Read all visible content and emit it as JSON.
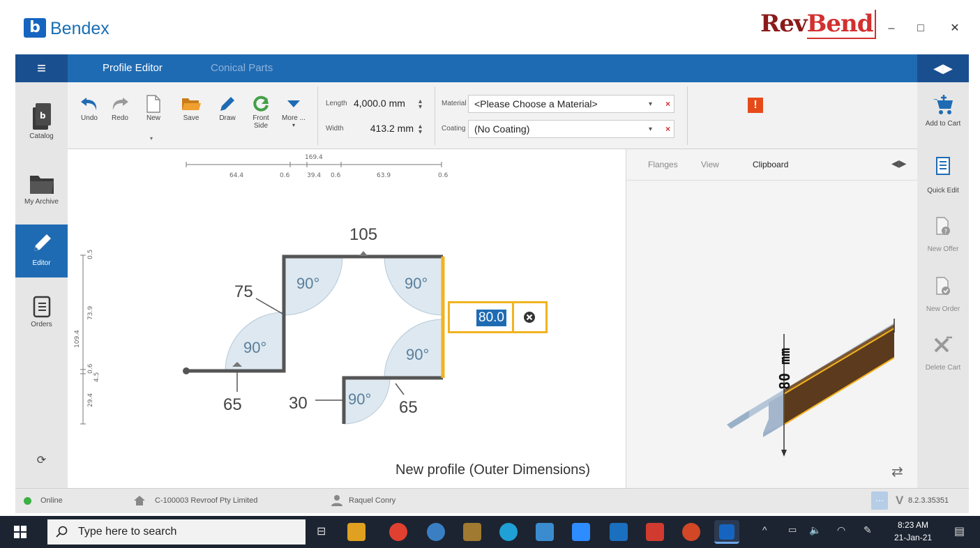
{
  "app": {
    "title": "Bendex",
    "logo_letter": "b",
    "brand_left": "Rev",
    "brand_right": "Bend"
  },
  "window_controls": {
    "minimize": "–",
    "maximize": "□",
    "close": "✕"
  },
  "header": {
    "menu_icon": "hamburger-icon",
    "tabs": [
      {
        "label": "Profile Editor",
        "active": true
      },
      {
        "label": "Conical Parts",
        "active": false
      }
    ],
    "collapse_icon": "◀▶"
  },
  "sidebar": {
    "items": [
      {
        "label": "Catalog",
        "icon": "catalog-icon"
      },
      {
        "label": "My Archive",
        "icon": "folder-icon"
      },
      {
        "label": "Editor",
        "icon": "pencil-icon",
        "active": true
      },
      {
        "label": "Orders",
        "icon": "orders-icon"
      }
    ],
    "sync_icon": "⟳"
  },
  "toolbar": {
    "buttons": [
      {
        "label": "Undo"
      },
      {
        "label": "Redo"
      },
      {
        "label": "New"
      },
      {
        "label": "Save"
      },
      {
        "label": "Draw"
      },
      {
        "label": "Front Side"
      },
      {
        "label": "More ..."
      }
    ],
    "length_label": "Length",
    "length_value": "4,000.0 mm",
    "width_label": "Width",
    "width_value": "413.2 mm",
    "material_label": "Material",
    "material_value": "<Please Choose a Material>",
    "coating_label": "Coating",
    "coating_value": "(No Coating)",
    "warning": "!"
  },
  "right_sidebar": {
    "items": [
      {
        "label": "Add to Cart"
      },
      {
        "label": "Quick Edit"
      },
      {
        "label": "New Offer"
      },
      {
        "label": "New Order"
      },
      {
        "label": "Delete Cart"
      }
    ]
  },
  "canvas": {
    "dimension_total": "169.4",
    "dimension_segments": [
      "64.4",
      "0.6",
      "39.4",
      "0.6",
      "63.9",
      "0.6"
    ],
    "vertical_total": "109.4",
    "vertical_segments": [
      "0.5",
      "73.9",
      "0.6",
      "4.5",
      "29.4"
    ],
    "flange_labels": [
      "105",
      "75",
      "65",
      "30",
      "65"
    ],
    "angles": [
      "90°",
      "90°",
      "90°",
      "90°",
      "90°"
    ],
    "edit_value": "80.0",
    "profile_title": "New profile (Outer Dimensions)"
  },
  "right_panel": {
    "tabs": [
      {
        "label": "Flanges",
        "active": false
      },
      {
        "label": "View",
        "active": false
      },
      {
        "label": "Clipboard",
        "active": true
      }
    ],
    "dimension_label": "80 mm"
  },
  "status": {
    "online": "Online",
    "online_color": "#3cb043",
    "company": "C-100003 Revroof Pty Limited",
    "user": "Raquel Conry",
    "version": "8.2.3.35351"
  },
  "taskbar": {
    "search_placeholder": "Type here to search",
    "time": "8:23 AM",
    "date": "21-Jan-21"
  }
}
